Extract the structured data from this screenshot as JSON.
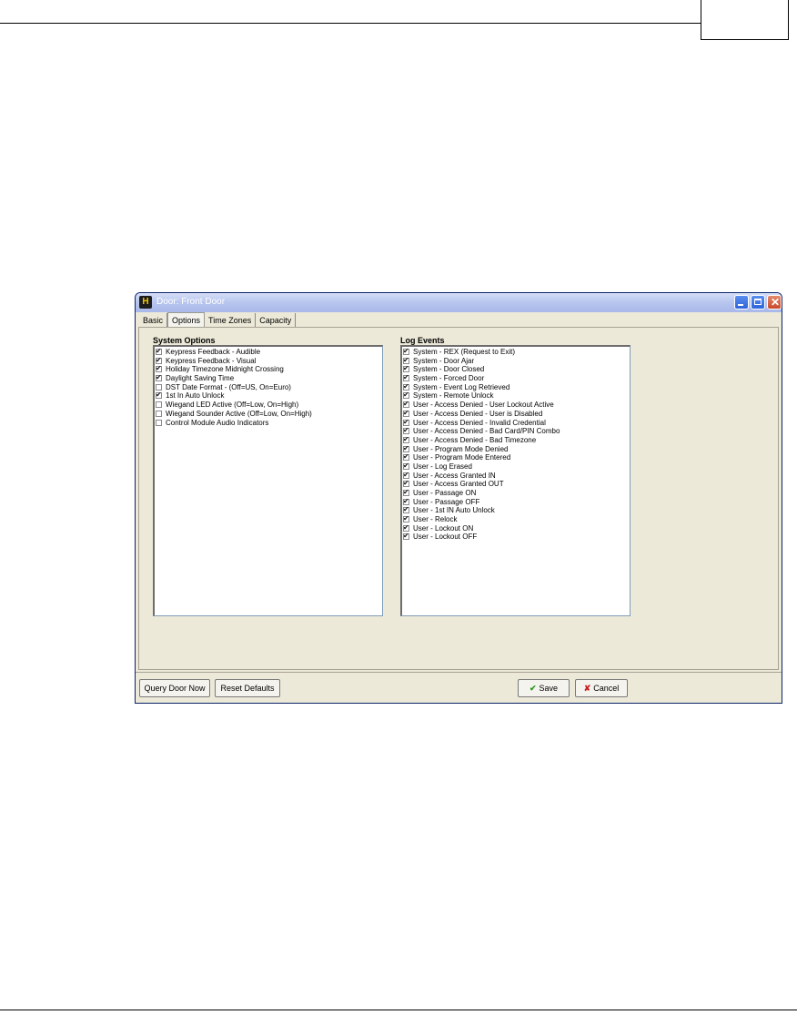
{
  "window": {
    "title": "Door: Front Door",
    "app_icon": "H"
  },
  "tabs": [
    "Basic",
    "Options",
    "Time Zones",
    "Capacity"
  ],
  "active_tab": "Options",
  "system_options": {
    "label": "System Options",
    "items": [
      {
        "label": "Keypress Feedback - Audible",
        "checked": true
      },
      {
        "label": "Keypress Feedback - Visual",
        "checked": true
      },
      {
        "label": "Holiday Timezone Midnight Crossing",
        "checked": true
      },
      {
        "label": "Daylight Saving Time",
        "checked": true
      },
      {
        "label": "DST Date Format - (Off=US, On=Euro)",
        "checked": false
      },
      {
        "label": "1st In Auto Unlock",
        "checked": true
      },
      {
        "label": "Wiegand LED Active (Off=Low, On=High)",
        "checked": false
      },
      {
        "label": "Wiegand Sounder Active (Off=Low, On=High)",
        "checked": false
      },
      {
        "label": "Control Module Audio Indicators",
        "checked": false
      }
    ]
  },
  "log_events": {
    "label": "Log Events",
    "items": [
      {
        "label": "System - REX (Request to Exit)",
        "checked": true
      },
      {
        "label": "System - Door Ajar",
        "checked": true
      },
      {
        "label": "System - Door Closed",
        "checked": true
      },
      {
        "label": "System - Forced Door",
        "checked": true
      },
      {
        "label": "System - Event Log Retrieved",
        "checked": true
      },
      {
        "label": "System - Remote Unlock",
        "checked": true
      },
      {
        "label": "User - Access Denied - User Lockout Active",
        "checked": true
      },
      {
        "label": "User - Access Denied - User is Disabled",
        "checked": true
      },
      {
        "label": "User - Access Denied - Invalid Credential",
        "checked": true
      },
      {
        "label": "User - Access Denied - Bad Card/PIN Combo",
        "checked": true
      },
      {
        "label": "User - Access Denied - Bad Timezone",
        "checked": true
      },
      {
        "label": "User - Program Mode Denied",
        "checked": true
      },
      {
        "label": "User - Program Mode Entered",
        "checked": true
      },
      {
        "label": "User - Log Erased",
        "checked": true
      },
      {
        "label": "User - Access Granted IN",
        "checked": true
      },
      {
        "label": "User - Access Granted OUT",
        "checked": true
      },
      {
        "label": "User - Passage ON",
        "checked": true
      },
      {
        "label": "User - Passage OFF",
        "checked": true
      },
      {
        "label": "User - 1st IN Auto Unlock",
        "checked": true
      },
      {
        "label": "User - Relock",
        "checked": true
      },
      {
        "label": "User - Lockout ON",
        "checked": true
      },
      {
        "label": "User - Lockout OFF",
        "checked": true
      }
    ]
  },
  "buttons": {
    "query_door_now": "Query Door Now",
    "reset_defaults": "Reset Defaults",
    "save": "Save",
    "cancel": "Cancel"
  },
  "icons": {
    "save": "check-icon",
    "cancel": "x-icon",
    "minimize": "minimize-icon",
    "maximize": "maximize-icon",
    "close": "close-icon"
  },
  "colors": {
    "dialog_bg": "#ece9d8",
    "titlebar": "#b9c7ef",
    "save_icon": "#2c9a20",
    "cancel_icon": "#c81e1e"
  }
}
